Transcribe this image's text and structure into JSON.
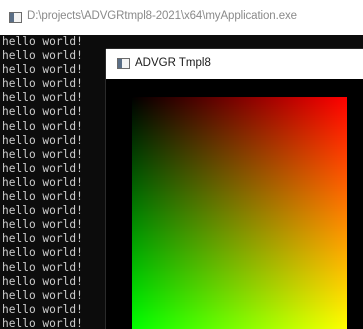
{
  "console": {
    "title": "D:\\projects\\ADVGRtmpl8-2021\\x64\\myApplication.exe",
    "lines": [
      "hello world!",
      "hello world!",
      "hello world!",
      "hello world!",
      "hello world!",
      "hello world!",
      "hello world!",
      "hello world!",
      "hello world!",
      "hello world!",
      "hello world!",
      "hello world!",
      "hello world!",
      "hello world!",
      "hello world!",
      "hello world!",
      "hello world!",
      "hello world!",
      "hello world!",
      "hello world!",
      "hello world!"
    ],
    "background_color": "#0c0c0c",
    "text_color": "#cccccc",
    "icon": "console-app-icon"
  },
  "render_window": {
    "title": "ADVGR Tmpl8",
    "icon": "app-window-icon",
    "gradient": {
      "top_left": "#000000",
      "top_right": "#ff0000",
      "bottom_left": "#00ff00",
      "bottom_right": "#ffff00"
    }
  }
}
